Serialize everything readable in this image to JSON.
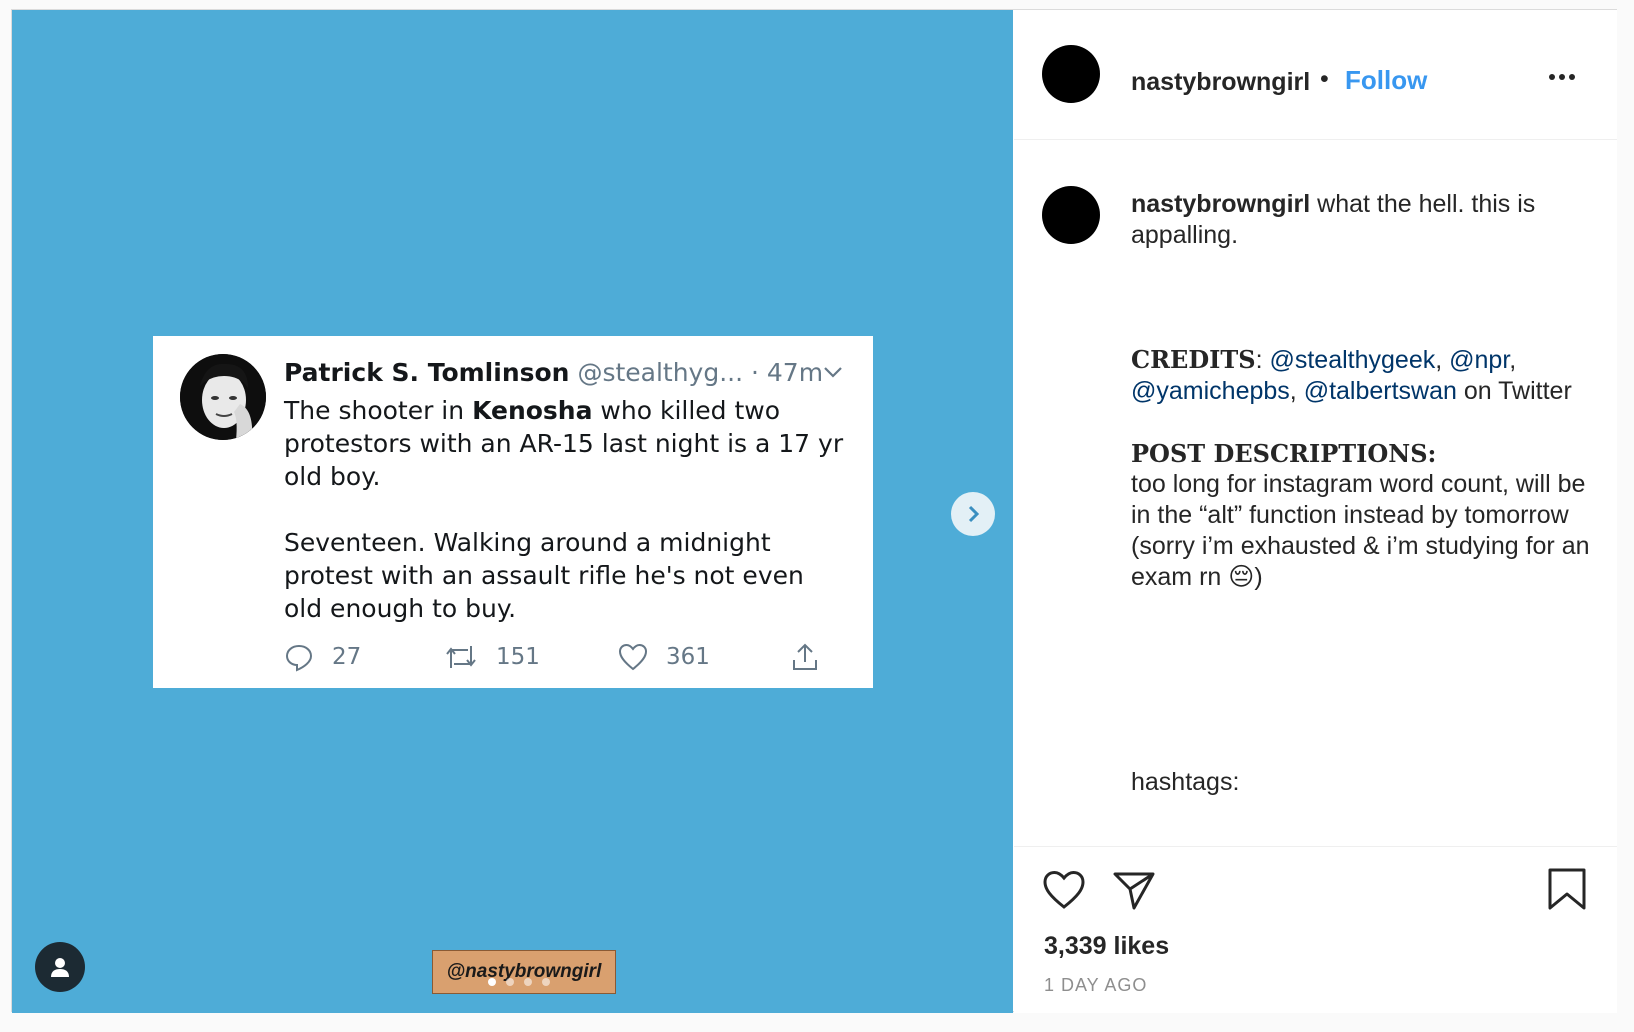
{
  "media": {
    "tweet": {
      "author": "Patrick S. Tomlinson",
      "handle_time": "@stealthyg... · 47m",
      "line1_pre": "The shooter in ",
      "line1_bold": "Kenosha",
      "line1_post": " who killed two protestors with an AR-15 last night is a 17 yr old boy.",
      "paragraph2": "Seventeen. Walking around a midnight protest with an assault rifle he's not even old enough to buy.",
      "replies": "27",
      "retweets": "151",
      "likes": "361"
    },
    "watermark": "@nastybrowngirl",
    "carousel": {
      "count": 4,
      "active_index": 0
    }
  },
  "header": {
    "username": "nastybrowngirl",
    "separator": "•",
    "follow_label": "Follow"
  },
  "caption": {
    "username": "nastybrowngirl",
    "text": " what the hell. this is appalling.",
    "credits_heading": "CREDITS",
    "credits_colon": ": ",
    "mention1": "@stealthygeek",
    "comma1": ", ",
    "mention2": "@npr",
    "comma2": ", ",
    "mention3": "@yamichepbs",
    "comma3": ", ",
    "mention4": "@talbertswan",
    "credits_tail": " on Twitter",
    "desc_heading": "POST DESCRIPTIONS:",
    "desc_text": "too long for instagram word count, will be in the “alt” function instead by tomorrow (sorry i’m exhausted & i’m studying for an exam rn 😔)",
    "hashtags": "hashtags:"
  },
  "footer": {
    "likes": "3,339 likes",
    "time_ago": "1 DAY AGO"
  },
  "icons": [
    "chevron-right-icon",
    "user-icon",
    "heart-icon",
    "share-icon",
    "bookmark-icon",
    "more-icon"
  ]
}
